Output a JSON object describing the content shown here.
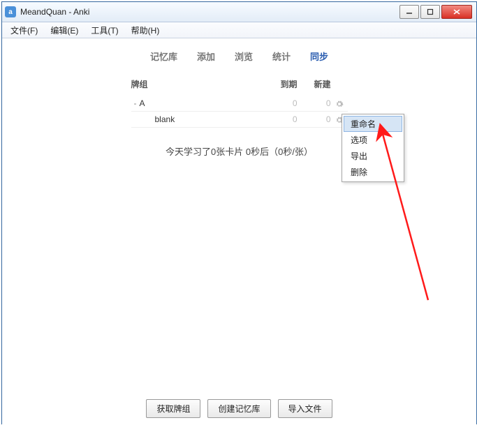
{
  "window": {
    "title": "MeandQuan - Anki"
  },
  "menubar": {
    "file": "文件(F)",
    "edit": "编辑(E)",
    "tools": "工具(T)",
    "help": "帮助(H)"
  },
  "topnav": {
    "decks": "记忆库",
    "add": "添加",
    "browse": "浏览",
    "stats": "统计",
    "sync": "同步"
  },
  "deck_table": {
    "header": {
      "name": "牌组",
      "due": "到期",
      "new": "新建"
    },
    "rows": [
      {
        "toggle": "-",
        "name": "A",
        "due": 0,
        "new": 0,
        "child": false
      },
      {
        "toggle": "",
        "name": "blank",
        "due": 0,
        "new": 0,
        "child": true
      }
    ]
  },
  "summary": "今天学习了0张卡片 0秒后（0秒/张）",
  "bottom": {
    "get": "获取牌组",
    "create": "创建记忆库",
    "import": "导入文件"
  },
  "context_menu": {
    "rename": "重命名",
    "options": "选项",
    "export": "导出",
    "delete": "删除"
  }
}
